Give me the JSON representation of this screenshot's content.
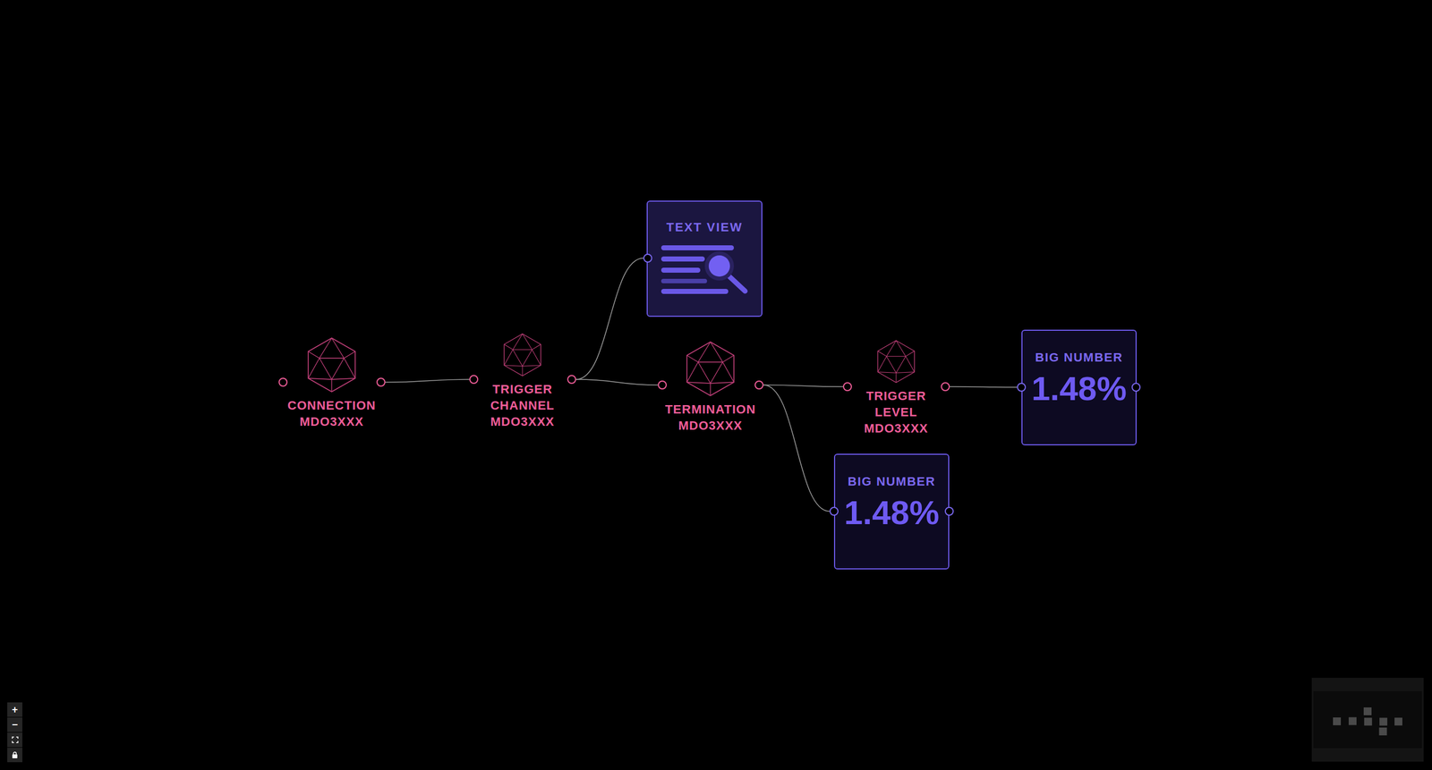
{
  "nodes": [
    {
      "kind": "device",
      "lines": [
        "CONNECTION",
        "MDO3XXX"
      ]
    },
    {
      "kind": "device",
      "lines": [
        "TRIGGER",
        "CHANNEL",
        "MDO3XXX"
      ]
    },
    {
      "kind": "textview",
      "title": "TEXT VIEW"
    },
    {
      "kind": "device",
      "lines": [
        "TERMINATION",
        "MDO3XXX"
      ]
    },
    {
      "kind": "device",
      "lines": [
        "TRIGGER",
        "LEVEL",
        "MDO3XXX"
      ]
    },
    {
      "kind": "bignumber",
      "title": "BIG NUMBER",
      "value": "1.48%"
    },
    {
      "kind": "bignumber",
      "title": "BIG NUMBER",
      "value": "1.48%"
    }
  ],
  "controls": [
    {
      "kind": "zoomin",
      "label": "+"
    },
    {
      "kind": "zoomout",
      "label": "−"
    },
    {
      "kind": "fit"
    },
    {
      "kind": "lock"
    }
  ]
}
